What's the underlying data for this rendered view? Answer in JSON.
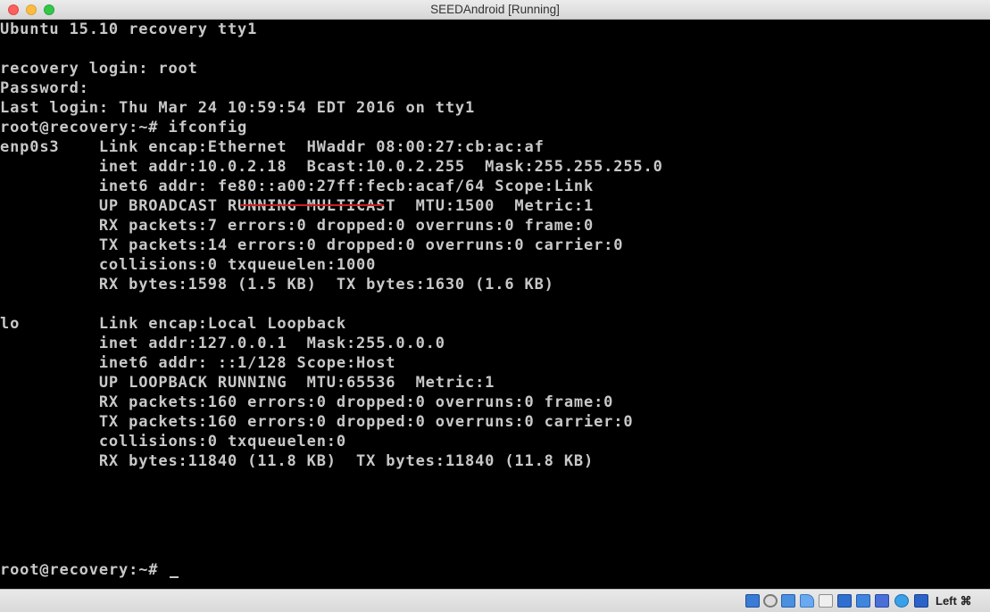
{
  "window": {
    "title": "SEEDAndroid [Running]"
  },
  "terminal": {
    "lines": [
      "Ubuntu 15.10 recovery tty1",
      "",
      "recovery login: root",
      "Password:",
      "Last login: Thu Mar 24 10:59:54 EDT 2016 on tty1",
      "root@recovery:~# ifconfig",
      "enp0s3    Link encap:Ethernet  HWaddr 08:00:27:cb:ac:af",
      "          inet addr:10.0.2.18  Bcast:10.0.2.255  Mask:255.255.255.0",
      "          inet6 addr: fe80::a00:27ff:fecb:acaf/64 Scope:Link",
      "          UP BROADCAST RUNNING MULTICAST  MTU:1500  Metric:1",
      "          RX packets:7 errors:0 dropped:0 overruns:0 frame:0",
      "          TX packets:14 errors:0 dropped:0 overruns:0 carrier:0",
      "          collisions:0 txqueuelen:1000",
      "          RX bytes:1598 (1.5 KB)  TX bytes:1630 (1.6 KB)",
      "",
      "lo        Link encap:Local Loopback",
      "          inet addr:127.0.0.1  Mask:255.0.0.0",
      "          inet6 addr: ::1/128 Scope:Host",
      "          UP LOOPBACK RUNNING  MTU:65536  Metric:1",
      "          RX packets:160 errors:0 dropped:0 overruns:0 frame:0",
      "          TX packets:160 errors:0 dropped:0 overruns:0 carrier:0",
      "          collisions:0 txqueuelen:0",
      "          RX bytes:11840 (11.8 KB)  TX bytes:11840 (11.8 KB)",
      "",
      "root@recovery:~# "
    ],
    "text_color": "#c8c8c8",
    "background_color": "#000000",
    "annotation_color": "#cc1f1f"
  },
  "statusbar": {
    "icons": [
      "hard-disk-icon",
      "optical-drive-icon",
      "usb-icon",
      "shared-folders-icon",
      "display-icon",
      "network-icon",
      "screen-capture-icon",
      "video-capture-icon",
      "mouse-integration-icon",
      "keyboard-capture-icon"
    ],
    "host_key_label": "Left ⌘"
  }
}
